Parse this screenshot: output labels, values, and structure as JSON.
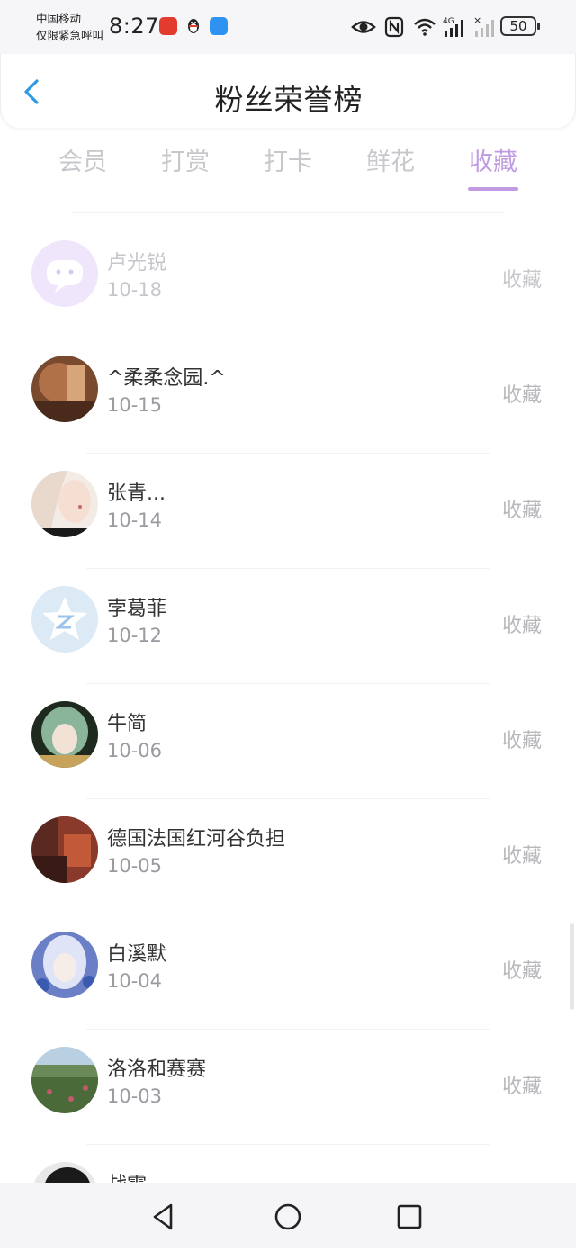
{
  "status_bar": {
    "carrier_line1": "中国移动",
    "carrier_line2": "仅限紧急呼叫",
    "time": "8:27",
    "battery": "50",
    "network_label": "4G"
  },
  "header": {
    "title": "粉丝荣誉榜"
  },
  "tabs": [
    {
      "label": "会员"
    },
    {
      "label": "打赏"
    },
    {
      "label": "打卡"
    },
    {
      "label": "鲜花"
    },
    {
      "label": "收藏",
      "active": true
    }
  ],
  "list": [
    {
      "name": "卢光锐",
      "date": "10-18",
      "action": "收藏"
    },
    {
      "name": "^柔柔念园.^",
      "date": "10-15",
      "action": "收藏"
    },
    {
      "name": "张青...",
      "date": "10-14",
      "action": "收藏"
    },
    {
      "name": "孛葛菲",
      "date": "10-12",
      "action": "收藏"
    },
    {
      "name": "牛简",
      "date": "10-06",
      "action": "收藏"
    },
    {
      "name": "德国法国红河谷负担",
      "date": "10-05",
      "action": "收藏"
    },
    {
      "name": "白溪默",
      "date": "10-04",
      "action": "收藏"
    },
    {
      "name": "洛洛和赛赛",
      "date": "10-03",
      "action": "收藏"
    },
    {
      "name": "战霜",
      "date": "",
      "action": ""
    }
  ],
  "colors": {
    "accent": "#c09be2",
    "tab_inactive": "#c8c8cc",
    "back_arrow": "#2e9ae6"
  },
  "icons": [
    "back-arrow-icon",
    "eye-icon",
    "nfc-icon",
    "wifi-icon",
    "signal-icon",
    "nav-back-icon",
    "nav-home-icon",
    "nav-recents-icon"
  ]
}
